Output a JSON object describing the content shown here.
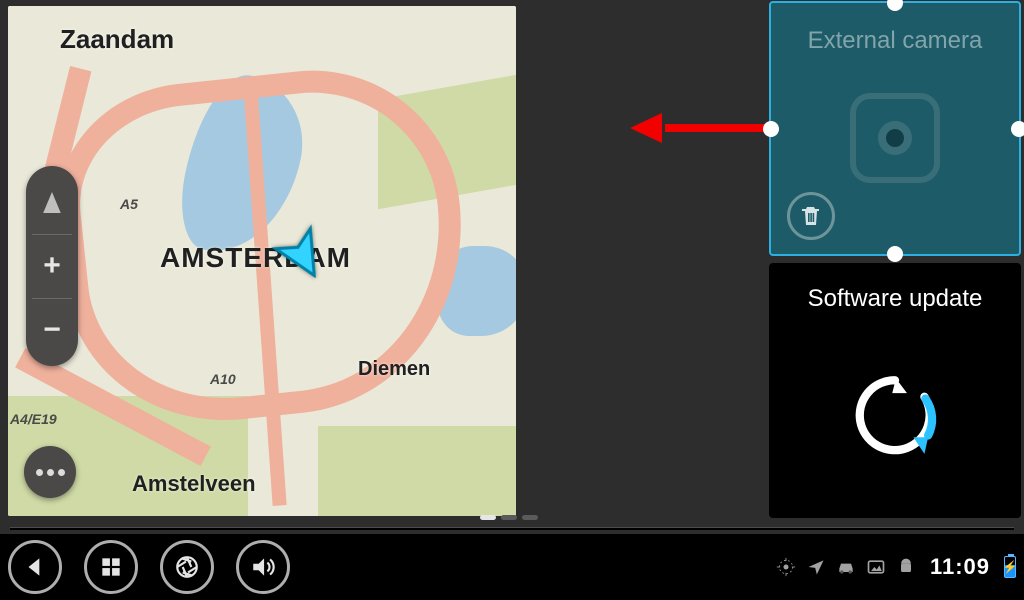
{
  "map": {
    "city_label": "AMSTERDAM",
    "labels": {
      "zaandam": "Zaandam",
      "diemen": "Diemen",
      "amstelveen": "Amstelveen"
    },
    "road_labels": {
      "a5": "A5",
      "a10": "A10",
      "a4e19": "A4/E19"
    },
    "controls": {
      "compass_glyph": "▲",
      "zoom_in": "+",
      "zoom_out": "−"
    }
  },
  "widgets": {
    "camera": {
      "title": "External camera"
    },
    "update": {
      "title": "Software update"
    }
  },
  "navbar": {
    "clock": "11:09"
  },
  "colors": {
    "widget_active_border": "#2cb0e2",
    "widget_camera_bg": "#1c5b67",
    "arrow": "#f20000",
    "spinner_accent": "#2cc2ff"
  }
}
